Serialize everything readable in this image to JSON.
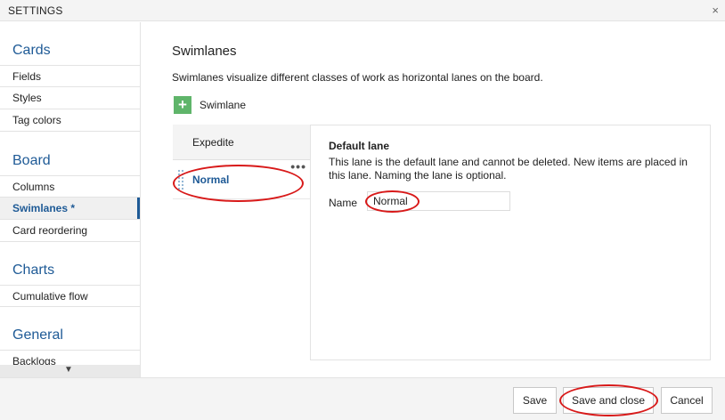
{
  "dialog": {
    "title": "SETTINGS",
    "close_glyph": "×"
  },
  "sidebar": {
    "groups": [
      {
        "title": "Cards",
        "items": [
          "Fields",
          "Styles",
          "Tag colors"
        ]
      },
      {
        "title": "Board",
        "items": [
          "Columns",
          "Swimlanes *",
          "Card reordering"
        ]
      },
      {
        "title": "Charts",
        "items": [
          "Cumulative flow"
        ]
      },
      {
        "title": "General",
        "items": [
          "Backlogs"
        ]
      }
    ],
    "active_item": "Swimlanes *",
    "scroll_arrow": "▼"
  },
  "main": {
    "heading": "Swimlanes",
    "description": "Swimlanes visualize different classes of work as horizontal lanes on the board.",
    "add_button": {
      "icon": "plus-icon",
      "glyph": "+",
      "label": "Swimlane"
    },
    "lanes": [
      {
        "label": "Expedite",
        "selected": false
      },
      {
        "label": "Normal",
        "selected": true,
        "more_glyph": "•••"
      }
    ],
    "detail": {
      "title": "Default lane",
      "text": "This lane is the default lane and cannot be deleted. New items are placed in this lane. Naming the lane is optional.",
      "name_label": "Name",
      "name_value": "Normal"
    }
  },
  "footer": {
    "save": "Save",
    "save_close": "Save and close",
    "cancel": "Cancel"
  },
  "colors": {
    "accent": "#1e5a96",
    "add_green": "#5fb56a",
    "annotation_red": "#d81919"
  }
}
